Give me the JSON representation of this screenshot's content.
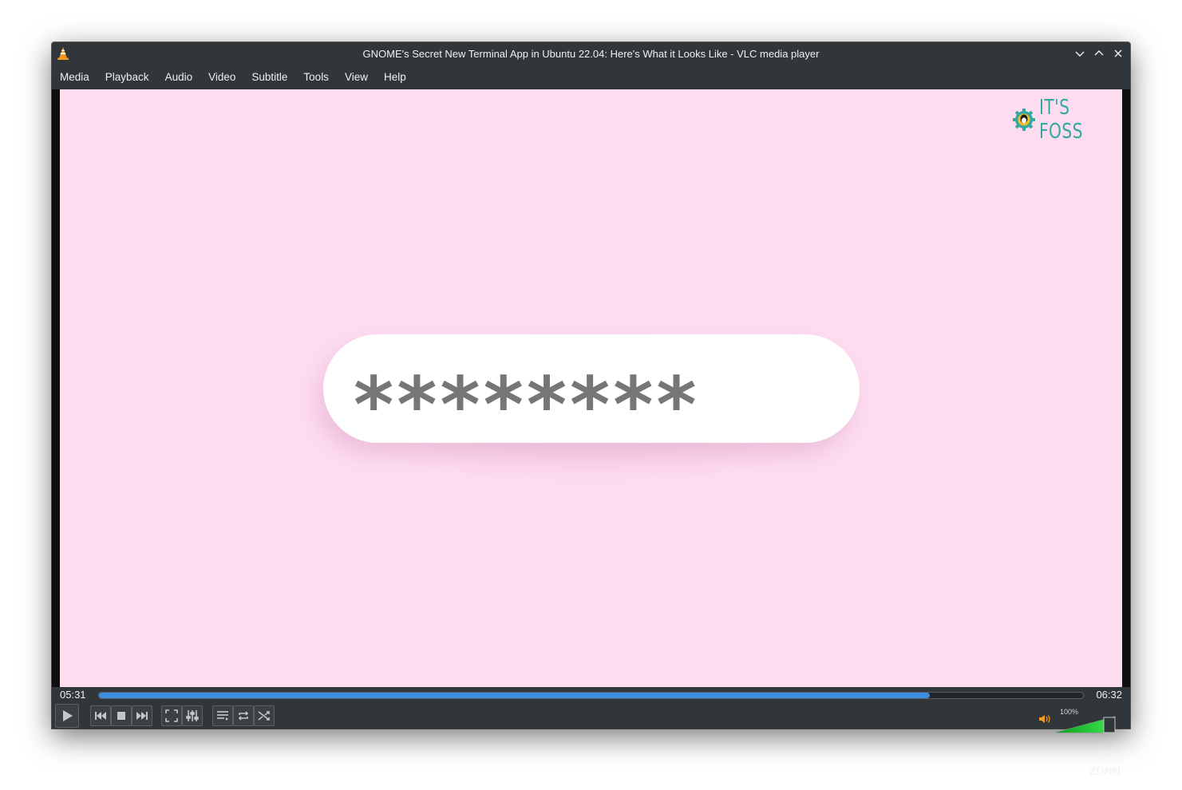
{
  "window": {
    "title": "GNOME's Secret New Terminal App in Ubuntu 22.04: Here's What it Looks Like - VLC media player"
  },
  "menubar": {
    "items": [
      {
        "label": "Media"
      },
      {
        "label": "Playback"
      },
      {
        "label": "Audio"
      },
      {
        "label": "Video"
      },
      {
        "label": "Subtitle"
      },
      {
        "label": "Tools"
      },
      {
        "label": "View"
      },
      {
        "label": "Help"
      }
    ]
  },
  "video": {
    "password_text": "********",
    "logo_text": "IT'S FOSS",
    "background_color": "#fddcf0"
  },
  "seekbar": {
    "elapsed": "05:31",
    "total": "06:32",
    "progress": 0.844,
    "fill_color": "#3d8ee0"
  },
  "controls": {
    "icons": [
      "play-icon",
      "previous-icon",
      "stop-icon",
      "next-icon",
      "fullscreen-icon",
      "extended-settings-icon",
      "playlist-icon",
      "loop-icon",
      "shuffle-icon"
    ]
  },
  "volume": {
    "label": "100%",
    "level": 1.0
  },
  "watermark": {
    "text": "ZDNN"
  }
}
